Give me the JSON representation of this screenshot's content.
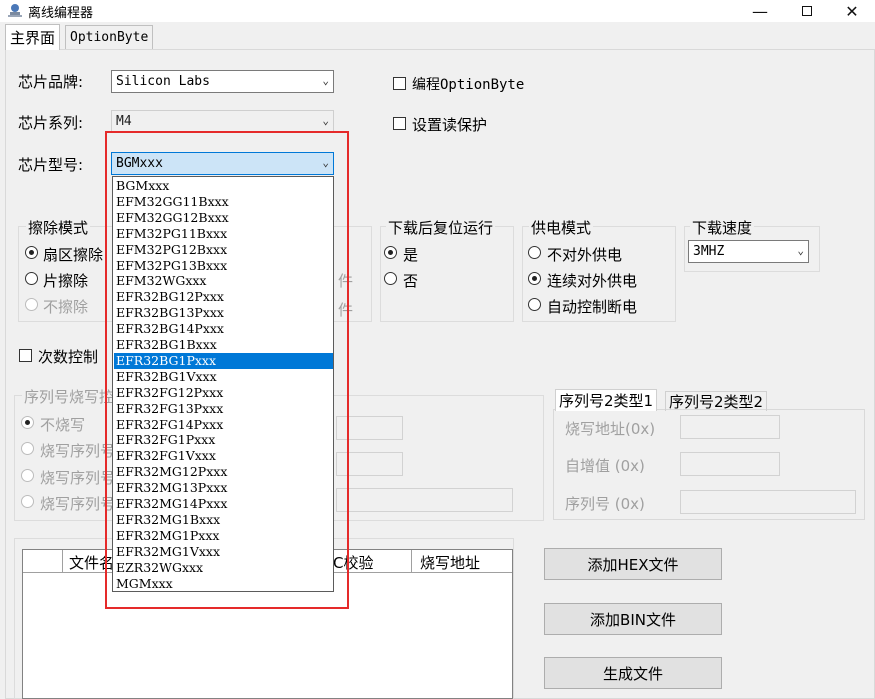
{
  "window": {
    "title": "离线编程器"
  },
  "tabs": [
    "主界面",
    "OptionByte"
  ],
  "chip": {
    "brand_label": "芯片品牌:",
    "brand_value": "Silicon Labs",
    "series_label": "芯片系列:",
    "series_value": "M4",
    "model_label": "芯片型号:",
    "model_value": "BGMxxx",
    "model_options": [
      "BGMxxx",
      "EFM32GG11Bxxx",
      "EFM32GG12Bxxx",
      "EFM32PG11Bxxx",
      "EFM32PG12Bxxx",
      "EFM32PG13Bxxx",
      "EFM32WGxxx",
      "EFR32BG12Pxxx",
      "EFR32BG13Pxxx",
      "EFR32BG14Pxxx",
      "EFR32BG1Bxxx",
      "EFR32BG1Pxxx",
      "EFR32BG1Vxxx",
      "EFR32FG12Pxxx",
      "EFR32FG13Pxxx",
      "EFR32FG14Pxxx",
      "EFR32FG1Pxxx",
      "EFR32FG1Vxxx",
      "EFR32MG12Pxxx",
      "EFR32MG13Pxxx",
      "EFR32MG14Pxxx",
      "EFR32MG1Bxxx",
      "EFR32MG1Pxxx",
      "EFR32MG1Vxxx",
      "EZR32WGxxx",
      "MGMxxx"
    ],
    "model_highlighted": "EFR32BG1Pxxx"
  },
  "options": {
    "program_optionbyte": "编程OptionByte",
    "read_protect": "设置读保护"
  },
  "erase": {
    "title": "擦除模式",
    "sector": "扇区擦除",
    "chip": "片擦除",
    "none": "不擦除"
  },
  "hidden_text": {
    "suffix_a": "件",
    "suffix_b": "件"
  },
  "reset": {
    "title": "下载后复位运行",
    "yes": "是",
    "no": "否"
  },
  "power": {
    "title": "供电模式",
    "off": "不对外供电",
    "continuous": "连续对外供电",
    "auto": "自动控制断电"
  },
  "speed": {
    "title": "下载速度",
    "value": "3MHZ"
  },
  "count_control": "次数控制",
  "serial": {
    "title": "序列号烧写控",
    "no_burn": "不烧写",
    "burn1": "烧写序列号",
    "burn2": "烧写序列号",
    "burn3": "烧写序列号"
  },
  "serial2": {
    "tab1": "序列号2类型1",
    "tab2": "序列号2类型2",
    "addr": "烧写地址(0x)",
    "incr": "自增值 (0x)",
    "sn": "序列号 (0x)"
  },
  "files": {
    "col_name": "文件名",
    "col_crc": "C校验",
    "col_addr": "烧写地址"
  },
  "buttons": {
    "add_hex": "添加HEX文件",
    "add_bin": "添加BIN文件",
    "generate": "生成文件"
  }
}
